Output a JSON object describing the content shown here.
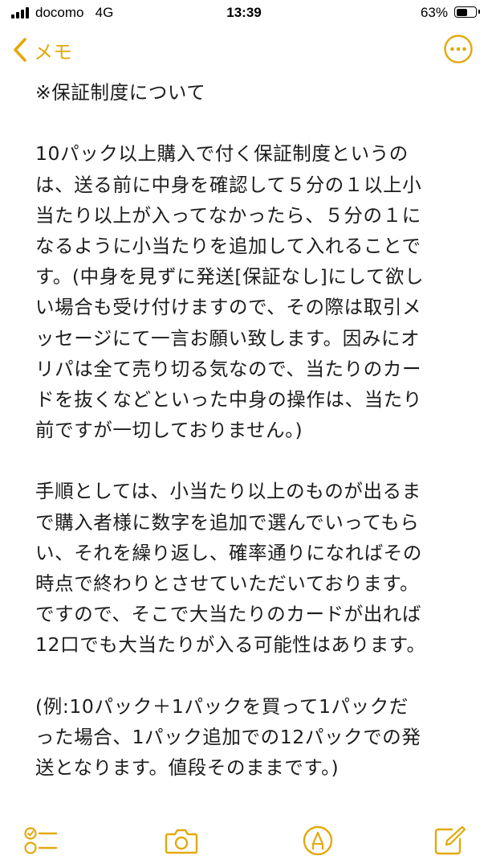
{
  "status_bar": {
    "carrier": "docomo",
    "network": "4G",
    "time": "13:39",
    "battery_percent": "63%",
    "battery_level": 0.63
  },
  "nav": {
    "back_label": "メモ",
    "ghost_title_1": "...",
    "ghost_title_2": "",
    "accent_color": "#e4a80b"
  },
  "note": {
    "lines": [
      "※保証制度について",
      "",
      "10パック以上購入で付く保証制度というの",
      "は、送る前に中身を確認して５分の１以上小",
      "当たり以上が入ってなかったら、５分の１に",
      "なるように小当たりを追加して入れることで",
      "す。(中身を見ずに発送[保証なし]にして欲し",
      "い場合も受け付けますので、その際は取引メ",
      "ッセージにて一言お願い致します。因みにオ",
      "リパは全て売り切る気なので、当たりのカー",
      "ドを抜くなどといった中身の操作は、当たり",
      "前ですが一切しておりません。)",
      "",
      "手順としては、小当たり以上のものが出るま",
      "で購入者様に数字を追加で選んでいってもら",
      "い、それを繰り返し、確率通りになればその",
      "時点で終わりとさせていただいております。",
      "ですので、そこで大当たりのカードが出れば",
      "12口でも大当たりが入る可能性はあります。",
      "",
      "(例:10パック＋1パックを買って1パックだ",
      "った場合、1パック追加での12パックでの発",
      "送となります。値段そのままです。)"
    ]
  },
  "toolbar": {
    "ghost_text": "..."
  },
  "icons": {
    "checklist": "checklist-icon",
    "camera": "camera-icon",
    "markup": "markup-pen-icon",
    "compose": "compose-icon",
    "more": "ellipsis-circle-icon",
    "back": "chevron-left-icon"
  }
}
